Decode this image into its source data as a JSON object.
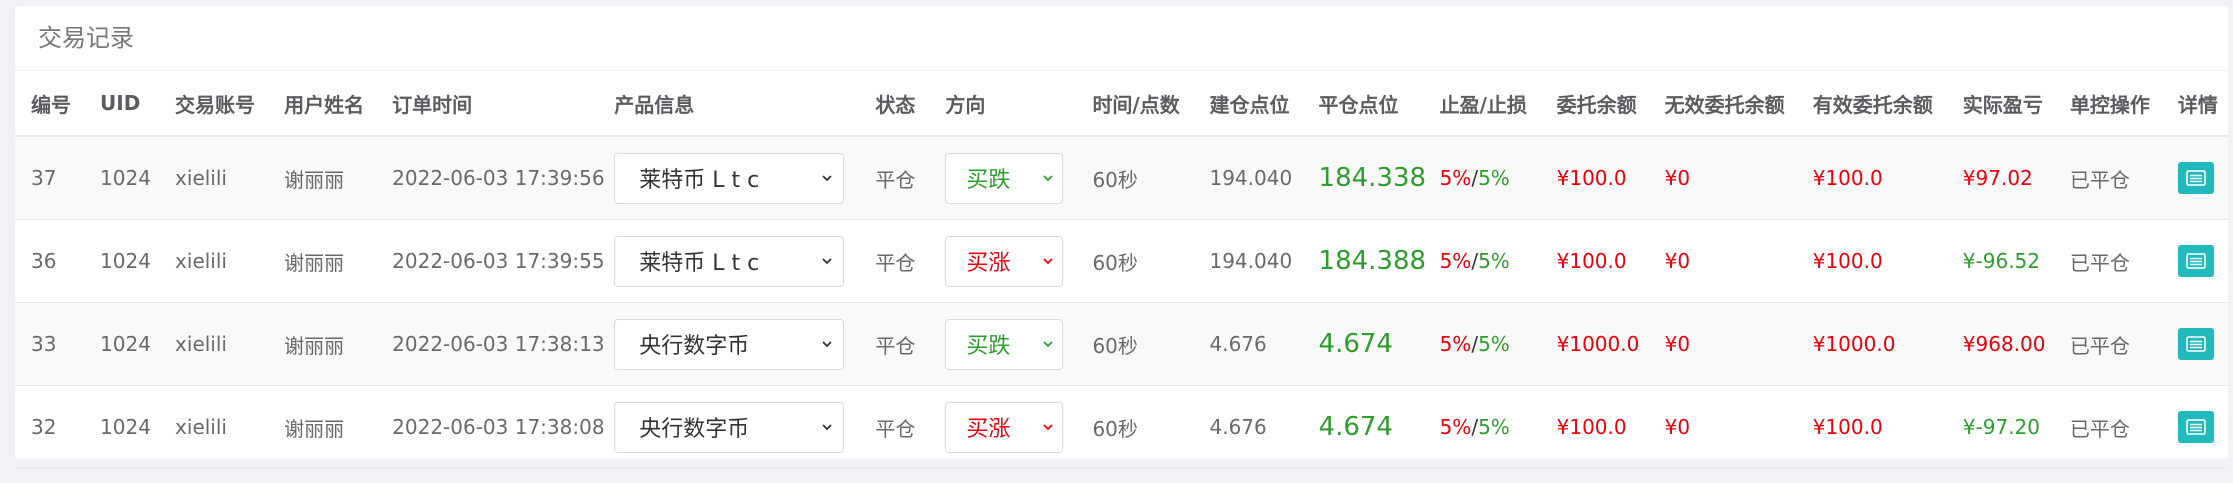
{
  "panel": {
    "title": "交易记录"
  },
  "columns": [
    "编号",
    "UID",
    "交易账号",
    "用户姓名",
    "订单时间",
    "产品信息",
    "状态",
    "方向",
    "时间/点数",
    "建仓点位",
    "平仓点位",
    "止盈/止损",
    "委托余额",
    "无效委托余额",
    "有效委托余额",
    "实际盈亏",
    "单控操作",
    "详情"
  ],
  "rows": [
    {
      "id": "37",
      "uid": "1024",
      "account": "xielili",
      "name": "谢丽丽",
      "time": "2022-06-03 17:39:56",
      "product": "莱特币 L t c",
      "status": "平仓",
      "direction": "买跌",
      "duration": "60秒",
      "open": "194.040",
      "close": "184.338",
      "tp": "5%",
      "sl": "5%",
      "entrust": "¥100.0",
      "invalid": "¥0",
      "valid": "¥100.0",
      "pnl": "¥97.02",
      "op": "已平仓"
    },
    {
      "id": "36",
      "uid": "1024",
      "account": "xielili",
      "name": "谢丽丽",
      "time": "2022-06-03 17:39:55",
      "product": "莱特币 L t c",
      "status": "平仓",
      "direction": "买涨",
      "duration": "60秒",
      "open": "194.040",
      "close": "184.388",
      "tp": "5%",
      "sl": "5%",
      "entrust": "¥100.0",
      "invalid": "¥0",
      "valid": "¥100.0",
      "pnl": "¥-96.52",
      "op": "已平仓"
    },
    {
      "id": "33",
      "uid": "1024",
      "account": "xielili",
      "name": "谢丽丽",
      "time": "2022-06-03 17:38:13",
      "product": "央行数字币",
      "status": "平仓",
      "direction": "买跌",
      "duration": "60秒",
      "open": "4.676",
      "close": "4.674",
      "tp": "5%",
      "sl": "5%",
      "entrust": "¥1000.0",
      "invalid": "¥0",
      "valid": "¥1000.0",
      "pnl": "¥968.00",
      "op": "已平仓"
    },
    {
      "id": "32",
      "uid": "1024",
      "account": "xielili",
      "name": "谢丽丽",
      "time": "2022-06-03 17:38:08",
      "product": "央行数字币",
      "status": "平仓",
      "direction": "买涨",
      "duration": "60秒",
      "open": "4.676",
      "close": "4.674",
      "tp": "5%",
      "sl": "5%",
      "entrust": "¥100.0",
      "invalid": "¥0",
      "valid": "¥100.0",
      "pnl": "¥-97.20",
      "op": "已平仓"
    }
  ],
  "colors": {
    "green": "#2e9c2e",
    "red": "#e8000b",
    "teal": "#21b9bb"
  },
  "icons": {
    "detail": "list-icon",
    "select": "chevron-down-icon"
  }
}
